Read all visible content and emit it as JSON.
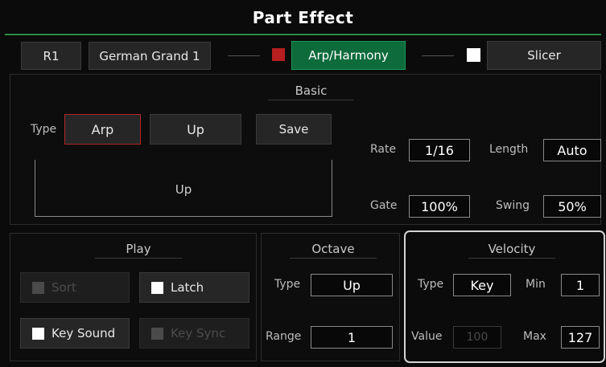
{
  "header": {
    "title": "Part Effect"
  },
  "toolbar": {
    "part": "R1",
    "voice": "German Grand 1",
    "arp_harmony": "Arp/Harmony",
    "slicer": "Slicer",
    "arp_indicator_color": "#b51f1f",
    "slicer_indicator_color": "#ffffff",
    "arp_active_color": "#0e6b3c"
  },
  "basic": {
    "title": "Basic",
    "type_label": "Type",
    "type_value": "Arp",
    "mode_value": "Up",
    "save_label": "Save",
    "display_text": "Up",
    "rate_label": "Rate",
    "rate_value": "1/16",
    "length_label": "Length",
    "length_value": "Auto",
    "gate_label": "Gate",
    "gate_value": "100%",
    "swing_label": "Swing",
    "swing_value": "50%"
  },
  "play": {
    "title": "Play",
    "sort_label": "Sort",
    "sort_checked": false,
    "sort_enabled": false,
    "latch_label": "Latch",
    "latch_checked": false,
    "key_sound_label": "Key Sound",
    "key_sound_checked": false,
    "key_sync_label": "Key Sync",
    "key_sync_enabled": false
  },
  "octave": {
    "title": "Octave",
    "type_label": "Type",
    "type_value": "Up",
    "range_label": "Range",
    "range_value": "1"
  },
  "velocity": {
    "title": "Velocity",
    "type_label": "Type",
    "type_value": "Key",
    "min_label": "Min",
    "min_value": "1",
    "value_label": "Value",
    "value_value": "100",
    "max_label": "Max",
    "max_value": "127"
  }
}
